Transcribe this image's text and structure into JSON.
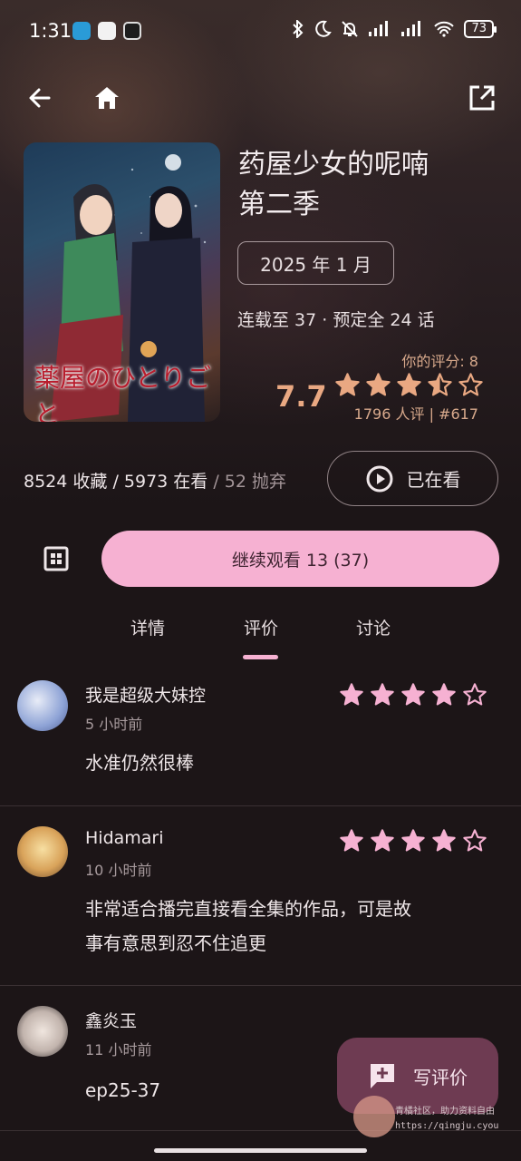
{
  "status_bar": {
    "time": "1:31",
    "battery": "73"
  },
  "anime": {
    "title_line1": "药屋少女的呢喃",
    "title_line2": "第二季",
    "poster_logo": "薬屋のひとりごと",
    "air_date": "2025 年 1 月",
    "episode_info": "连载至 37 · 预定全 24 话",
    "my_score_label": "你的评分: 8",
    "score": "7.7",
    "score_stars": 3.5,
    "score_meta": "1796 人评 | #617"
  },
  "stats": {
    "collected": "8524 收藏",
    "sep1": " / ",
    "watching": "5973 在看",
    "sep2": " / ",
    "dropped": "52 抛弃"
  },
  "actions": {
    "watching_label": "已在看",
    "continue_label": "继续观看 13 (37)"
  },
  "tabs": [
    "详情",
    "评价",
    "讨论"
  ],
  "active_tab": 1,
  "reviews": [
    {
      "name": "我是超级大妹控",
      "time": "5 小时前",
      "text_lines": [
        "水准仍然很棒"
      ],
      "stars": 4
    },
    {
      "name": "Hidamari",
      "time": "10 小时前",
      "text_lines": [
        "非常适合播完直接看全集的作品，可是故",
        "事有意思到忍不住追更"
      ],
      "stars": 4
    },
    {
      "name": "鑫炎玉",
      "time": "11 小时前",
      "text_lines": [
        "ep25-37"
      ],
      "stars": 0
    }
  ],
  "fab": {
    "label": "写评价"
  },
  "watermark": {
    "line1": "青橘社区，助力资料自由",
    "line2": "https://qingju.cyou"
  },
  "colors": {
    "accent_pink": "#f6b1d2",
    "score_orange": "#e9a882",
    "fab_bg": "#6e3b52"
  }
}
